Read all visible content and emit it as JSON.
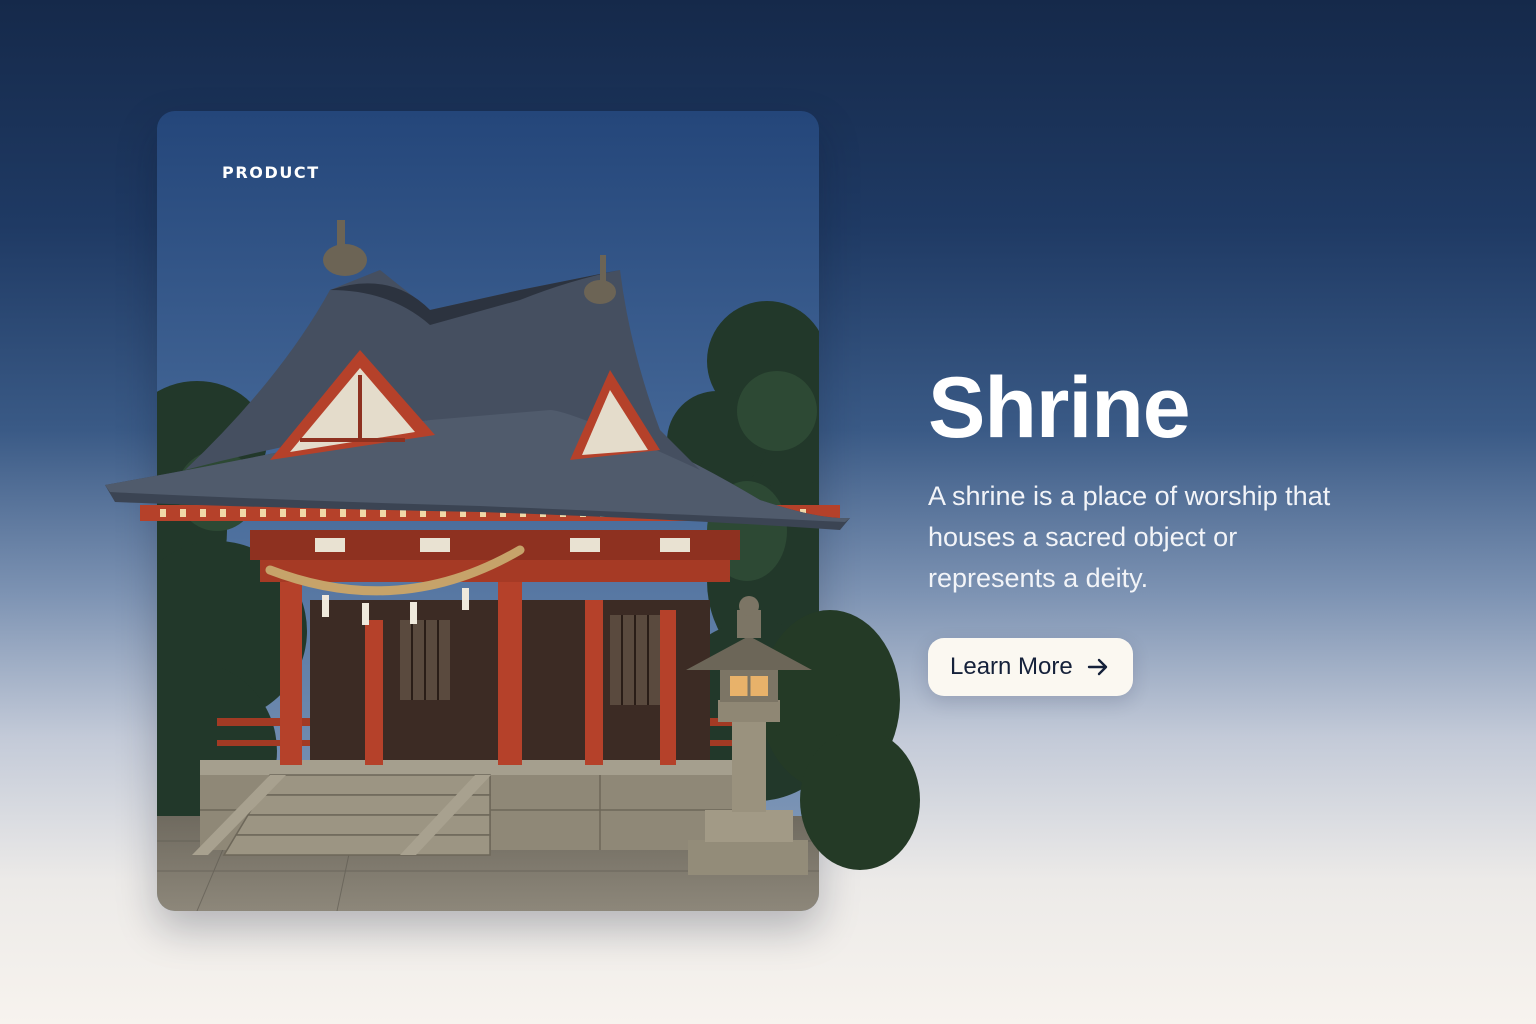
{
  "card": {
    "eyebrow": "PRODUCT",
    "image_subject": "shrine-illustration"
  },
  "hero": {
    "title": "Shrine",
    "description": "A shrine is a place of worship that houses a sacred object or represents a deity."
  },
  "cta": {
    "label": "Learn More",
    "icon": "arrow-right-icon"
  },
  "colors": {
    "background_top": "#15294a",
    "background_bottom": "#f7f3ee",
    "button_bg": "#fbf8f1",
    "button_text": "#15213a",
    "shrine_red": "#b5412a",
    "roof": "#3b4453",
    "foliage": "#243a26"
  }
}
